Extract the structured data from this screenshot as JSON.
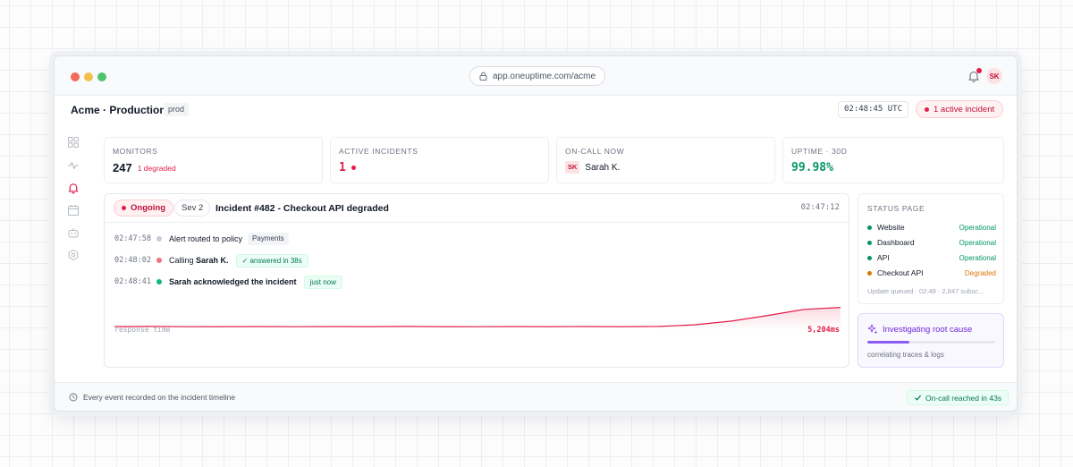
{
  "browser": {
    "url": "app.oneuptime.com/acme",
    "avatar_initials": "SK"
  },
  "header": {
    "org_name": "Acme · Production",
    "env_badge": "prod",
    "clock": "02:48:45 UTC",
    "active_incident_label": "1 active incident"
  },
  "sidebar": {
    "items": [
      {
        "icon": "grid-icon",
        "active": false
      },
      {
        "icon": "activity-icon",
        "active": false
      },
      {
        "icon": "bell-icon",
        "active": true
      },
      {
        "icon": "calendar-icon",
        "active": false
      },
      {
        "icon": "bot-icon",
        "active": false
      },
      {
        "icon": "settings-icon",
        "active": false
      }
    ]
  },
  "stats": {
    "monitors": {
      "label": "MONITORS",
      "value": "247",
      "sub": "1 degraded"
    },
    "incidents": {
      "label": "ACTIVE INCIDENTS",
      "value": "1"
    },
    "oncall": {
      "label": "ON-CALL NOW",
      "badge": "SK",
      "name": "Sarah K."
    },
    "uptime": {
      "label": "UPTIME · 30D",
      "value": "99.98%"
    }
  },
  "incident": {
    "status": "Ongoing",
    "severity": "Sev 2",
    "title": "Incident #482 - Checkout API degraded",
    "time": "02:47:12",
    "timeline": [
      {
        "time": "02:47:58",
        "text": "Alert routed to policy",
        "tag": "Payments"
      },
      {
        "time": "02:48:02",
        "text": "Calling",
        "bold": "Sarah K.",
        "tag": "✓ answered in 38s"
      },
      {
        "time": "02:48:41",
        "text": "Sarah acknowledged the incident",
        "tag": "just now"
      }
    ],
    "chart_label": "response time",
    "chart_value": "5,204ms"
  },
  "chart_data": {
    "type": "area",
    "x": [
      0,
      1,
      2,
      3,
      4,
      5,
      6,
      7,
      8,
      9,
      10,
      11,
      12,
      13,
      14,
      15,
      16,
      17,
      18,
      19,
      20
    ],
    "values": [
      420,
      460,
      400,
      430,
      450,
      410,
      440,
      420,
      470,
      430,
      410,
      450,
      430,
      440,
      420,
      460,
      900,
      1800,
      3200,
      4700,
      5204
    ],
    "ylim": [
      0,
      8000
    ],
    "title": "",
    "xlabel": "",
    "ylabel": "response time",
    "color": "#e11d48"
  },
  "status_page": {
    "title": "STATUS PAGE",
    "services": [
      {
        "name": "Website",
        "status": "Operational",
        "color": "#059669"
      },
      {
        "name": "Dashboard",
        "status": "Operational",
        "color": "#059669"
      },
      {
        "name": "API",
        "status": "Operational",
        "color": "#059669"
      },
      {
        "name": "Checkout API",
        "status": "Degraded",
        "color": "#d97706"
      }
    ],
    "footer": "Update queued · 02:49 · 2,847 subsc..."
  },
  "ai_card": {
    "title": "Investigating root cause",
    "progress": 0.33,
    "subtitle": "correlating traces & logs"
  },
  "footer": {
    "left": "Every event recorded on the incident timeline",
    "right": "On-call reached in 43s"
  }
}
